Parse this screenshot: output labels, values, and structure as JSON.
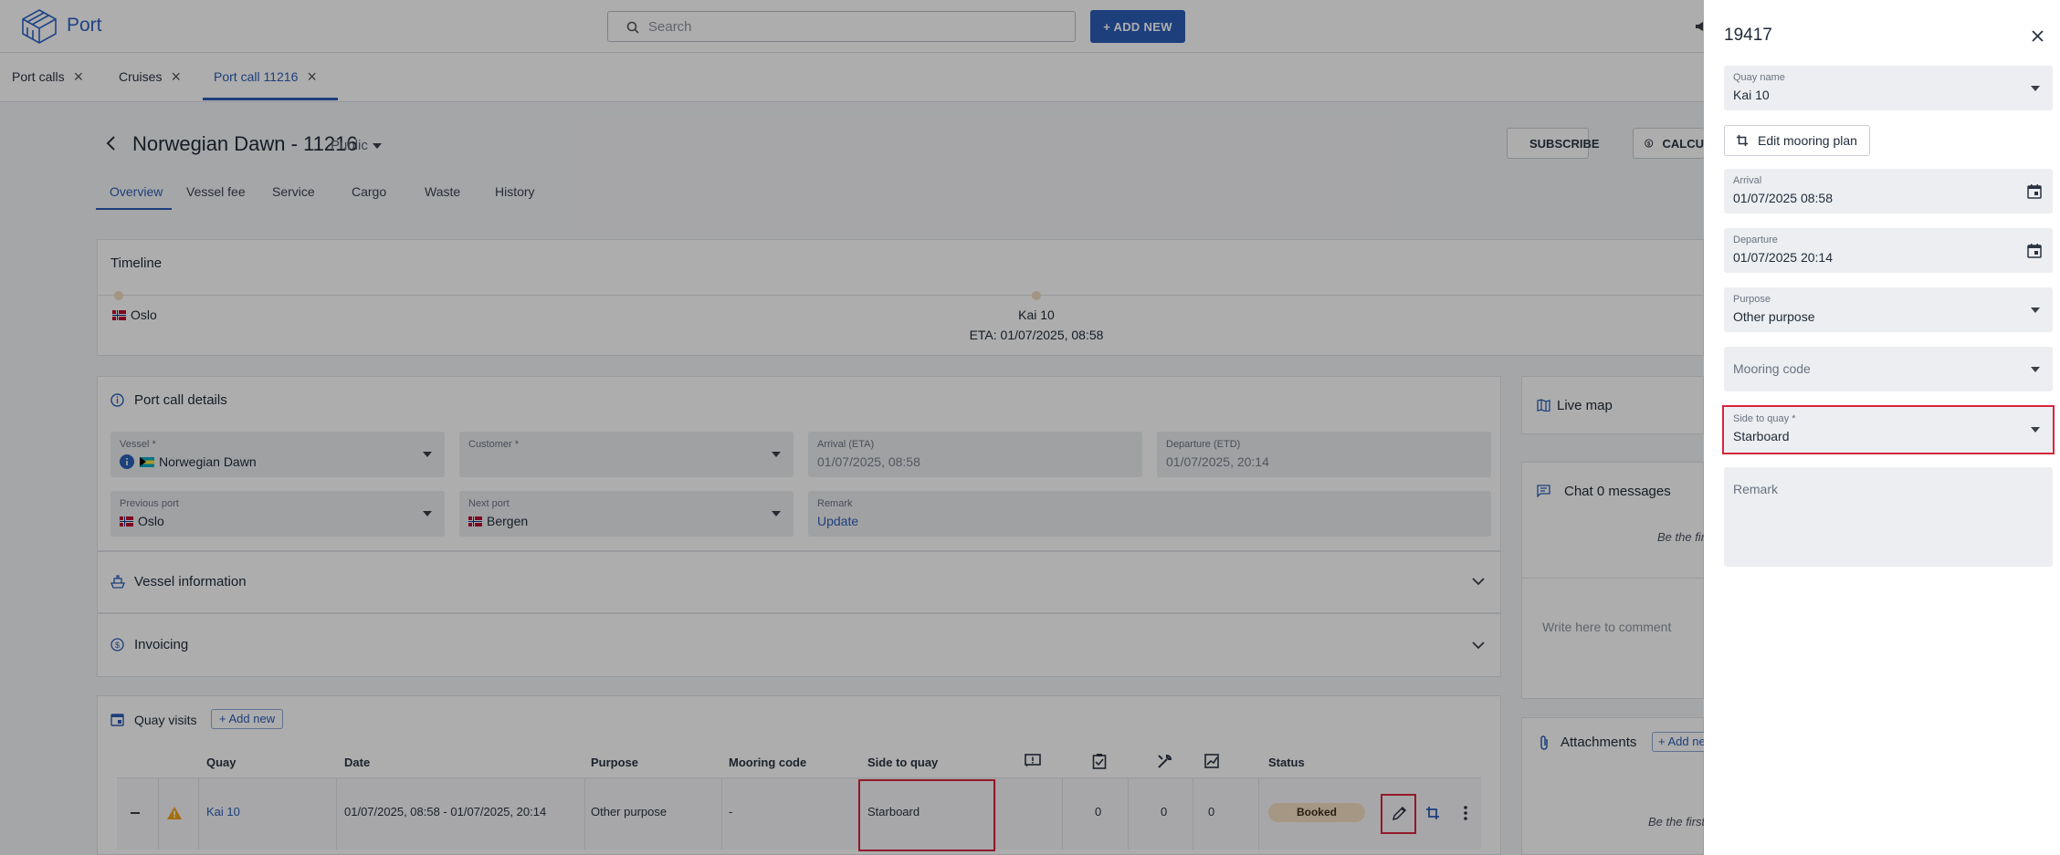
{
  "app": {
    "name": "Port"
  },
  "search": {
    "placeholder": "Search"
  },
  "add_new": "+ ADD NEW",
  "tabs": [
    {
      "label": "Port calls"
    },
    {
      "label": "Cruises"
    },
    {
      "label": "Port call 11216"
    }
  ],
  "header": {
    "title": "Norwegian Dawn - 11216",
    "visibility": "Public",
    "subscribe": "SUBSCRIBE",
    "calc": "CALCU"
  },
  "subtabs": [
    "Overview",
    "Vessel fee",
    "Service",
    "Cargo",
    "Waste",
    "History"
  ],
  "timeline": {
    "title": "Timeline",
    "from": "Oslo",
    "quay": "Kai 10",
    "eta": "ETA: 01/07/2025, 08:58"
  },
  "details": {
    "title": "Port call details",
    "vessel": {
      "label": "Vessel *",
      "value": "Norwegian Dawn"
    },
    "customer": {
      "label": "Customer *"
    },
    "arrival": {
      "label": "Arrival (ETA)",
      "value": "01/07/2025, 08:58"
    },
    "departure": {
      "label": "Departure (ETD)",
      "value": "01/07/2025, 20:14"
    },
    "prev_port": {
      "label": "Previous port",
      "value": "Oslo"
    },
    "next_port": {
      "label": "Next port",
      "value": "Bergen"
    },
    "remark": {
      "label": "Remark",
      "value": "Update"
    }
  },
  "sections": {
    "vessel_info": "Vessel information",
    "invoicing": "Invoicing"
  },
  "quay_visits": {
    "title": "Quay visits",
    "add": "+ Add new",
    "columns": {
      "quay": "Quay",
      "date": "Date",
      "purpose": "Purpose",
      "mooring": "Mooring code",
      "side": "Side to quay",
      "status": "Status"
    },
    "row": {
      "quay": "Kai 10",
      "date": "01/07/2025, 08:58 - 01/07/2025, 20:14",
      "purpose": "Other purpose",
      "mooring": "-",
      "side": "Starboard",
      "c1": "0",
      "c2": "0",
      "c3": "0",
      "status": "Booked"
    }
  },
  "right": {
    "live_map": "Live map",
    "chat": "Chat 0 messages",
    "be_first": "Be the fir",
    "comment_ph": "Write here to comment",
    "attachments": "Attachments",
    "att_add": "+ Add ne",
    "att_first": "Be the first"
  },
  "panel": {
    "title": "19417",
    "quay_name": {
      "label": "Quay name",
      "value": "Kai 10"
    },
    "edit_mooring": "Edit mooring plan",
    "arrival": {
      "label": "Arrival",
      "value": "01/07/2025 08:58"
    },
    "departure": {
      "label": "Departure",
      "value": "01/07/2025 20:14"
    },
    "purpose": {
      "label": "Purpose",
      "value": "Other purpose"
    },
    "mooring_code": {
      "placeholder": "Mooring code"
    },
    "side": {
      "label": "Side to quay *",
      "value": "Starboard"
    },
    "remark": {
      "placeholder": "Remark"
    }
  },
  "colors": {
    "accent": "#2c5eb7",
    "highlight": "#d7263d",
    "booked": "#f3dfc1"
  }
}
